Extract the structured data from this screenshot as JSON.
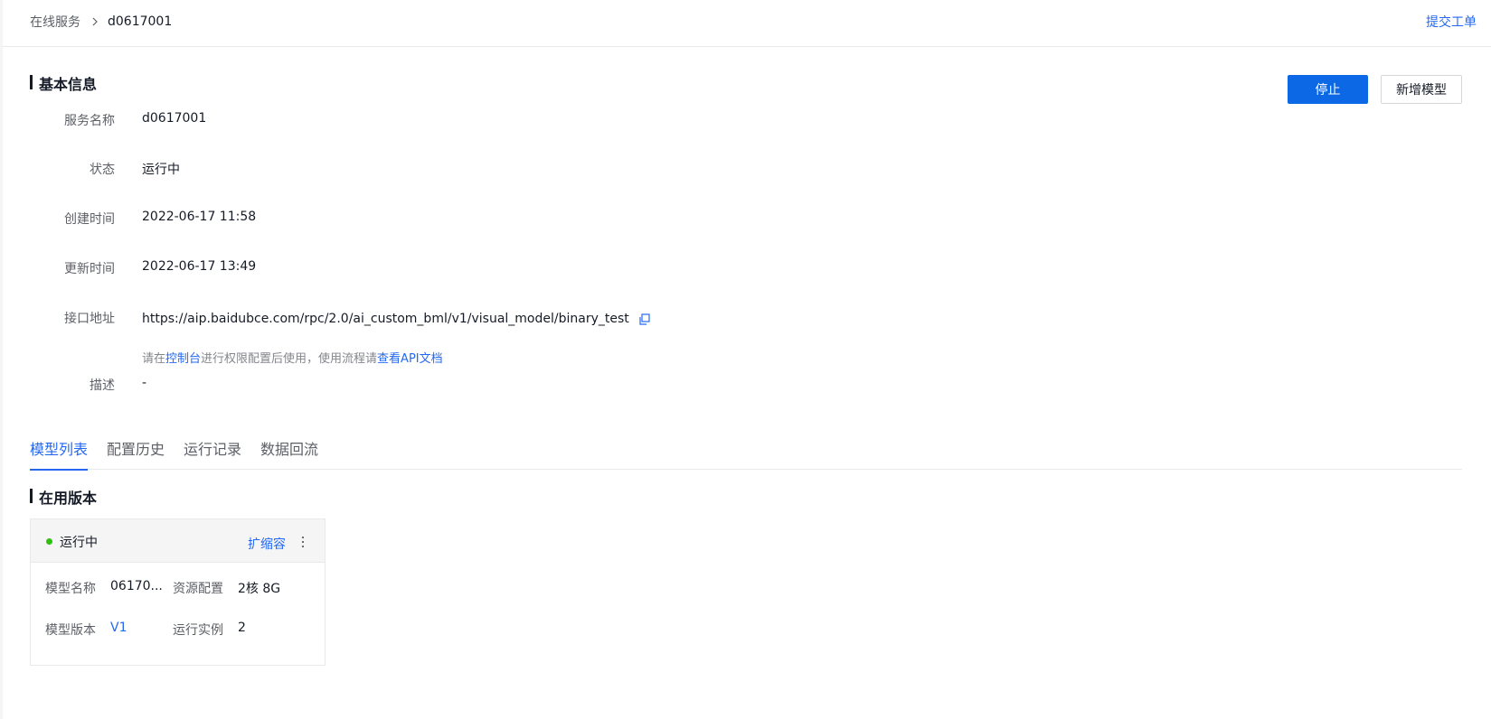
{
  "breadcrumb": {
    "parent": "在线服务",
    "current": "d0617001"
  },
  "header": {
    "ticket_label": "提交工单"
  },
  "basic_info": {
    "title": "基本信息",
    "stop_label": "停止",
    "add_model_label": "新增模型",
    "rows": [
      {
        "label": "服务名称",
        "value": "d0617001"
      },
      {
        "label": "状态",
        "value": "运行中"
      },
      {
        "label": "创建时间",
        "value": "2022-06-17 11:58"
      },
      {
        "label": "更新时间",
        "value": "2022-06-17 13:49"
      },
      {
        "label": "接口地址",
        "value": "https://aip.baidubce.com/rpc/2.0/ai_custom_bml/v1/visual_model/binary_test"
      },
      {
        "label": "描述",
        "value": "-"
      }
    ],
    "hint": {
      "prefix": "请在",
      "console_link": "控制台",
      "middle": "进行权限配置后使用，使用流程请",
      "doc_link": "查看API文档"
    }
  },
  "tabs": [
    {
      "label": "模型列表"
    },
    {
      "label": "配置历史"
    },
    {
      "label": "运行记录"
    },
    {
      "label": "数据回流"
    }
  ],
  "in_use": {
    "title": "在用版本",
    "card": {
      "status": "运行中",
      "scale_label": "扩缩容",
      "model_name_label": "模型名称",
      "model_name_value": "06170...",
      "resource_label": "资源配置",
      "resource_value": "2核 8G",
      "version_label": "模型版本",
      "version_value": "V1",
      "instances_label": "运行实例",
      "instances_value": "2"
    }
  }
}
